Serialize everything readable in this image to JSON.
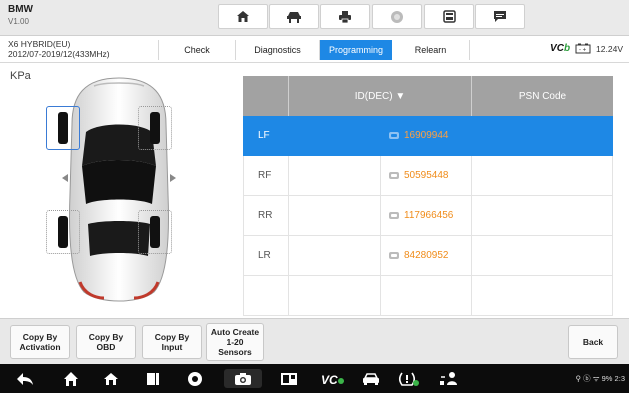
{
  "title_bar": {
    "brand": "BMW",
    "version": "V1.00",
    "buttons": [
      {
        "icon": "home-icon"
      },
      {
        "icon": "vehicle-lift-icon"
      },
      {
        "icon": "printer-icon"
      },
      {
        "icon": "help-icon"
      },
      {
        "icon": "save-icon"
      },
      {
        "icon": "message-icon"
      }
    ]
  },
  "vehicle": {
    "model": "X6 HYBRID(EU)",
    "detail": "2012/07-2019/12(433MHz)"
  },
  "tabs": [
    {
      "label": "Check",
      "active": false
    },
    {
      "label": "Diagnostics",
      "active": false
    },
    {
      "label": "Programming",
      "active": true
    },
    {
      "label": "Relearn",
      "active": false
    }
  ],
  "vci": {
    "logo_main": "VC",
    "logo_accent": "b",
    "voltage": "12.24V"
  },
  "main": {
    "unit": "KPa",
    "table": {
      "header_id": "ID(DEC) ▼",
      "header_psn": "PSN Code",
      "rows": [
        {
          "pos": "LF",
          "id": "16909944",
          "psn": "",
          "selected": true
        },
        {
          "pos": "RF",
          "id": "50595448",
          "psn": "",
          "selected": false
        },
        {
          "pos": "RR",
          "id": "117966456",
          "psn": "",
          "selected": false
        },
        {
          "pos": "LR",
          "id": "84280952",
          "psn": "",
          "selected": false
        },
        {
          "pos": "",
          "id": "",
          "psn": "",
          "selected": false
        }
      ]
    }
  },
  "function_bar": {
    "copy_activation": "Copy By\nActivation",
    "copy_obd": "Copy By\nOBD",
    "copy_input": "Copy By\nInput",
    "auto_create": "Auto Create\n1-20\nSensors",
    "back": "Back"
  },
  "status": {
    "text": "⚲ ⓑ ᯤ 9% 2:3"
  },
  "colors": {
    "accent": "#1e88e5",
    "id_value": "#f08c1a",
    "header_bg": "#a2a2a2"
  }
}
